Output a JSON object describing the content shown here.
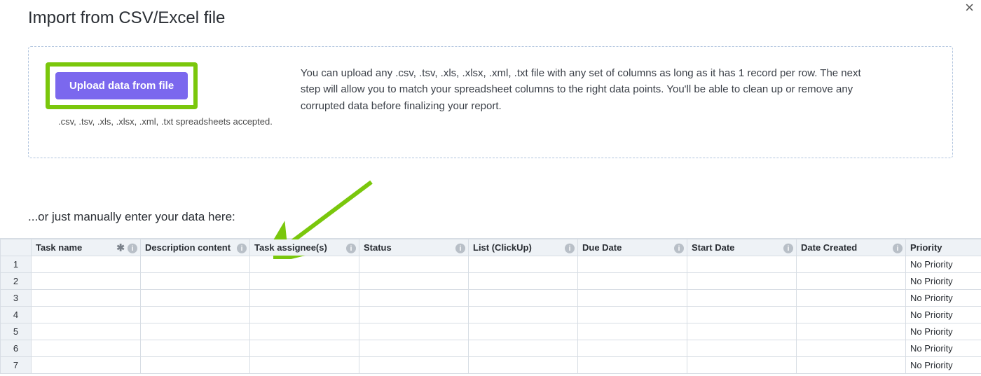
{
  "title": "Import from CSV/Excel file",
  "close_label": "×",
  "upload": {
    "button_label": "Upload data from file",
    "accepts_text": ".csv, .tsv, .xls, .xlsx, .xml, .txt spreadsheets accepted."
  },
  "explain_text": "You can upload any .csv, .tsv, .xls, .xlsx, .xml, .txt file with any set of columns as long as it has 1 record per row. The next step will allow you to match your spreadsheet columns to the right data points. You'll be able to clean up or remove any corrupted data before finalizing your report.",
  "manual_label": "...or just manually enter your data here:",
  "columns": [
    {
      "label": "Task name",
      "required": true,
      "info": true
    },
    {
      "label": "Description content",
      "required": false,
      "info": true
    },
    {
      "label": "Task assignee(s)",
      "required": false,
      "info": true
    },
    {
      "label": "Status",
      "required": false,
      "info": true
    },
    {
      "label": "List (ClickUp)",
      "required": false,
      "info": true
    },
    {
      "label": "Due Date",
      "required": false,
      "info": true
    },
    {
      "label": "Start Date",
      "required": false,
      "info": true
    },
    {
      "label": "Date Created",
      "required": false,
      "info": true
    },
    {
      "label": "Priority",
      "required": false,
      "info": false
    }
  ],
  "row_count": 7,
  "default_priority": "No Priority",
  "info_glyph": "i",
  "required_glyph": "✱"
}
